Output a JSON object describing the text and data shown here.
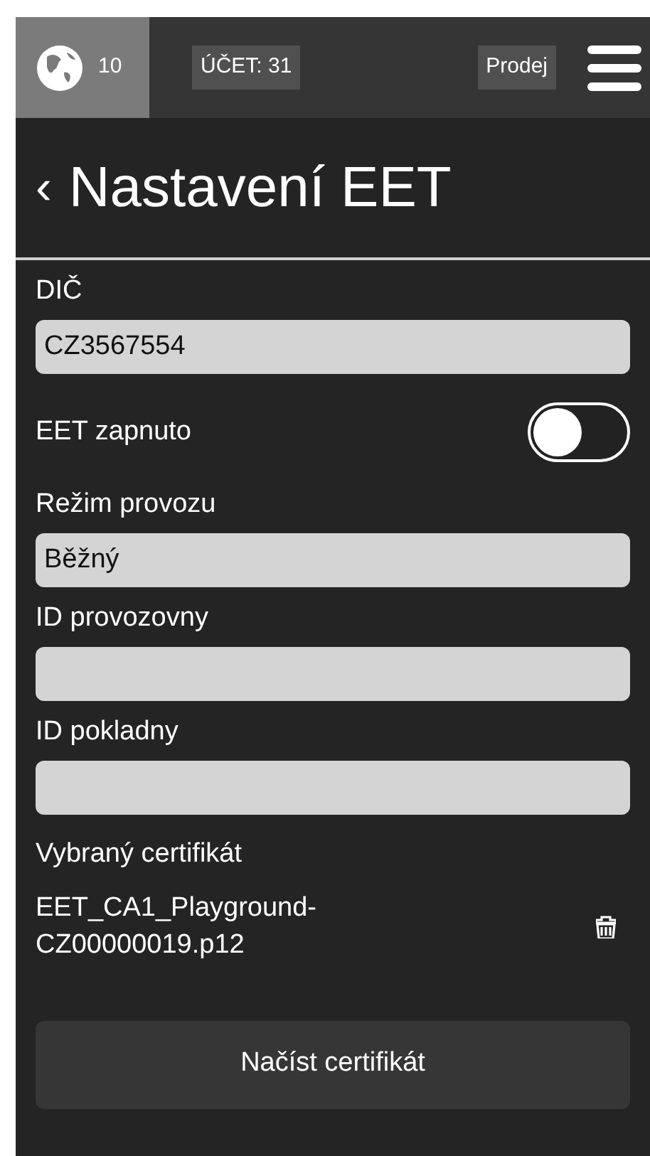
{
  "top_bar": {
    "globe_count": "10",
    "account": "ÚČET: 31",
    "mode": "Prodej"
  },
  "header": {
    "back": "‹",
    "title": "Nastavení EET"
  },
  "fields": [
    {
      "kind": "input",
      "label": "DIČ",
      "value": "CZ3567554"
    },
    {
      "kind": "toggle",
      "label": "EET zapnuto",
      "on": false
    },
    {
      "kind": "input",
      "label": "Režim provozu",
      "value": "Běžný"
    },
    {
      "kind": "input",
      "label": "ID provozovny"
    },
    {
      "kind": "input",
      "label": "ID pokladny"
    }
  ],
  "certificate": {
    "label": "Vybraný certifikát",
    "file": "EET_CA1_Playground-CZ00000019.p12"
  },
  "load_button": "Načíst certifikát"
}
